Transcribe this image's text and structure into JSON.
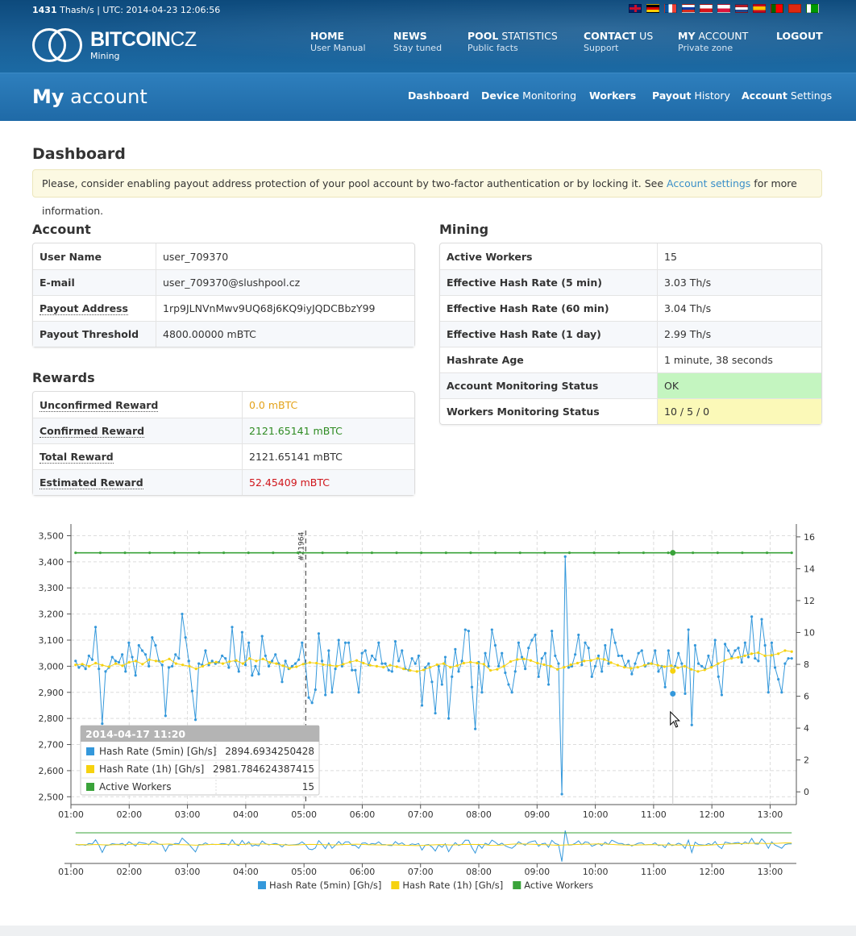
{
  "header": {
    "rate_value": "1431",
    "rate_unit": "Thash/s",
    "separator": "|",
    "utc": "UTC: 2014-04-23 12:06:56",
    "logo_bold": "BITCOIN",
    "logo_cz": "CZ",
    "logo_sub": "Mining",
    "nav": [
      {
        "bold": "HOME",
        "rest": "",
        "sub": "User Manual"
      },
      {
        "bold": "NEWS",
        "rest": "",
        "sub": "Stay tuned"
      },
      {
        "bold": "POOL",
        "rest": " STATISTICS",
        "sub": "Public facts"
      },
      {
        "bold": "CONTACT",
        "rest": " US",
        "sub": "Support"
      },
      {
        "bold": "MY",
        "rest": " ACCOUNT",
        "sub": "Private zone"
      },
      {
        "bold": "LOGOUT",
        "rest": "",
        "sub": ""
      }
    ],
    "flags": [
      "uk-flag-icon",
      "de-flag-icon",
      "fr-flag-icon",
      "ru-flag-icon",
      "cz-flag-icon",
      "pl-flag-icon",
      "nl-flag-icon",
      "es-flag-icon",
      "pt-flag-icon",
      "cn-flag-icon",
      "eo-flag-icon"
    ]
  },
  "subheader": {
    "title_bold": "My",
    "title_rest": " account",
    "tabs": [
      {
        "bold": "Dashboard",
        "rest": ""
      },
      {
        "bold": "Device",
        "rest": " Monitoring"
      },
      {
        "bold": "Workers",
        "rest": ""
      },
      {
        "bold": "Payout",
        "rest": " History"
      },
      {
        "bold": "Account",
        "rest": " Settings"
      }
    ]
  },
  "dashboard": {
    "heading": "Dashboard",
    "notice_before": "Please, consider enabling payout address protection of your pool account by two-factor authentication or by locking it. See ",
    "notice_link": "Account settings",
    "notice_after": " for more information."
  },
  "account": {
    "heading": "Account",
    "rows": [
      {
        "label": "User Name",
        "value": "user_709370"
      },
      {
        "label": "E-mail",
        "value": "user_709370@slushpool.cz"
      },
      {
        "label": "Payout Address",
        "value": "1rp9JLNVnMwv9UQ68j6KQ9iyJQDCBbzY99"
      },
      {
        "label": "Payout Threshold",
        "value": "4800.00000 mBTC"
      }
    ]
  },
  "rewards": {
    "heading": "Rewards",
    "rows": [
      {
        "label": "Unconfirmed Reward",
        "value": "0.0 mBTC",
        "color": "#e3a21a"
      },
      {
        "label": "Confirmed Reward",
        "value": "2121.65141 mBTC",
        "color": "#2e8b22"
      },
      {
        "label": "Total Reward",
        "value": "2121.65141 mBTC",
        "color": "#333333"
      },
      {
        "label": "Estimated Reward",
        "value": "52.45409 mBTC",
        "color": "#d0151b"
      }
    ]
  },
  "mining": {
    "heading": "Mining",
    "rows": [
      {
        "label": "Active Workers",
        "value": "15"
      },
      {
        "label": "Effective Hash Rate (5 min)",
        "value": "3.03 Th/s"
      },
      {
        "label": "Effective Hash Rate (60 min)",
        "value": "3.04 Th/s"
      },
      {
        "label": "Effective Hash Rate (1 day)",
        "value": "2.99 Th/s"
      },
      {
        "label": "Hashrate Age",
        "value": "1 minute, 38 seconds"
      },
      {
        "label": "Account Monitoring Status",
        "value": "OK"
      },
      {
        "label": "Workers Monitoring Status",
        "value": "10 / 5 / 0"
      }
    ]
  },
  "tooltip": {
    "title": "2014-04-17 11:20",
    "rows": [
      {
        "name": "Hash Rate (5min) [Gh/s]",
        "value": "2894.6934250428",
        "color": "#3498db"
      },
      {
        "name": "Hash Rate (1h) [Gh/s]",
        "value": "2981.784624387415",
        "color": "#f6d20f"
      },
      {
        "name": "Active Workers",
        "value": "15",
        "color": "#3aa33a"
      }
    ]
  },
  "chart_data": {
    "type": "line",
    "x_ticks": [
      "01:00",
      "02:00",
      "03:00",
      "04:00",
      "05:00",
      "06:00",
      "07:00",
      "08:00",
      "09:00",
      "10:00",
      "11:00",
      "12:00",
      "13:00"
    ],
    "y_left_ticks": [
      "2,500",
      "2,600",
      "2,700",
      "2,800",
      "2,900",
      "3,000",
      "3,100",
      "3,200",
      "3,300",
      "3,400",
      "3,500"
    ],
    "y_right_ticks": [
      "0",
      "2",
      "4",
      "6",
      "8",
      "10",
      "12",
      "14",
      "16"
    ],
    "ylim_left": [
      2470,
      3520
    ],
    "ylim_right": [
      -0.8,
      16.4
    ],
    "x_range_hours": [
      1.0,
      13.45
    ],
    "marker_label": "#21964",
    "marker_x_hours": 5.03,
    "hover_x_hours": 11.33,
    "grid": true,
    "legend": "bottom",
    "series": [
      {
        "name": "Hash Rate (5min) [Gh/s]",
        "color": "#3498db",
        "axis": "left",
        "values": [
          3020,
          2995,
          3005,
          2990,
          3040,
          3025,
          3150,
          2990,
          2780,
          2980,
          2995,
          3035,
          3020,
          3015,
          3045,
          2980,
          3090,
          3035,
          2965,
          3080,
          3060,
          3045,
          3000,
          3110,
          3080,
          3020,
          3005,
          2810,
          2995,
          3000,
          3045,
          3030,
          3200,
          3110,
          3020,
          2905,
          2795,
          3010,
          3005,
          3060,
          3005,
          3020,
          3010,
          3015,
          3040,
          3030,
          2995,
          3150,
          3020,
          2980,
          3130,
          3005,
          3090,
          2965,
          3000,
          2970,
          3115,
          3040,
          3000,
          3020,
          3045,
          3010,
          2940,
          3020,
          2990,
          3000,
          3010,
          3025,
          3090,
          3010,
          2880,
          2860,
          2910,
          3125,
          3020,
          2890,
          3060,
          2900,
          2990,
          3100,
          3000,
          3090,
          3090,
          2985,
          2985,
          2900,
          3050,
          3060,
          3005,
          3040,
          3025,
          3090,
          3010,
          3010,
          2985,
          2980,
          3095,
          3020,
          3060,
          2990,
          2985,
          3030,
          3010,
          3040,
          2850,
          2995,
          3010,
          2940,
          2820,
          3000,
          2930,
          3035,
          2800,
          2960,
          3065,
          2980,
          3020,
          3140,
          3135,
          2920,
          2760,
          3015,
          2900,
          3050,
          3000,
          3140,
          3080,
          3000,
          3050,
          2975,
          2930,
          2900,
          2980,
          3090,
          3035,
          2990,
          3070,
          3100,
          3120,
          2960,
          3030,
          3050,
          2930,
          3135,
          3040,
          3010,
          2510,
          3420,
          2995,
          3000,
          3045,
          3120,
          3005,
          3090,
          3070,
          2960,
          3000,
          3040,
          2980,
          3080,
          3010,
          3140,
          3090,
          3040,
          3040,
          3000,
          3020,
          2970,
          3010,
          3050,
          3060,
          3000,
          3010,
          3010,
          3060,
          2980,
          3000,
          2920,
          3060,
          2980,
          3000,
          3050,
          3010,
          2895,
          3140,
          2775,
          3080,
          3010,
          3000,
          2990,
          3040,
          3000,
          3100,
          2960,
          2890,
          3085,
          3060,
          3035,
          3060,
          3070,
          3015,
          3090,
          3035,
          3190,
          3030,
          3020,
          3180,
          3080,
          2900,
          3090,
          2995,
          2950,
          2900,
          3010,
          3030,
          3030
        ]
      },
      {
        "name": "Hash Rate (1h) [Gh/s]",
        "color": "#f6d20f",
        "axis": "left",
        "values": [
          3005,
          3008,
          3000,
          3012,
          3004,
          2998,
          3010,
          3002,
          3015,
          3020,
          3008,
          3025,
          3020,
          3018,
          3028,
          3010,
          3005,
          3000,
          2990,
          3000,
          3012,
          3016,
          3010,
          3018,
          3022,
          3010,
          3030,
          3020,
          3028,
          3015,
          3010,
          3002,
          2992,
          2998,
          3008,
          3014,
          3012,
          3006,
          3004,
          3000,
          3008,
          3016,
          3022,
          3012,
          3004,
          3000,
          2996,
          3004,
          2998,
          2990,
          2984,
          2980,
          2986,
          2996,
          3006,
          3010,
          2996,
          3002,
          3012,
          3016,
          3012,
          3008,
          2984,
          2988,
          3000,
          3018,
          3026,
          3028,
          3022,
          3012,
          3006,
          3000,
          2988,
          2996,
          3006,
          3012,
          3020,
          3022,
          3030,
          3026,
          3014,
          3004,
          2996,
          2992,
          2996,
          3004,
          3010,
          3004,
          2998,
          3002,
          2994,
          3000,
          2988,
          2980,
          2986,
          2996,
          3010,
          3022,
          3030,
          3034,
          3040,
          3048,
          3052,
          3040,
          3042,
          3048,
          3060,
          3056
        ]
      },
      {
        "name": "Active Workers",
        "color": "#3aa33a",
        "axis": "right",
        "values": [
          15,
          15,
          15,
          15,
          15,
          15,
          15,
          15,
          15,
          15,
          15,
          15,
          15,
          15,
          15,
          15,
          15,
          15,
          15,
          15,
          15,
          15,
          15,
          15,
          15,
          15,
          15,
          15,
          15,
          15
        ]
      }
    ]
  }
}
